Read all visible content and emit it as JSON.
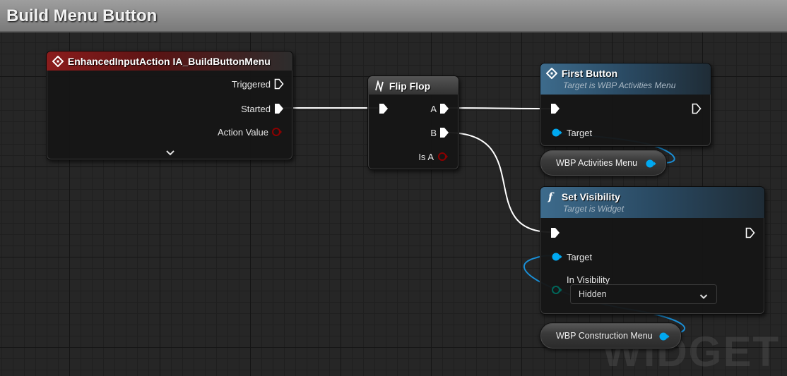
{
  "graph": {
    "title": "Build Menu Button",
    "watermark": "WIDGET"
  },
  "nodes": {
    "input_action": {
      "title": "EnhancedInputAction IA_BuildButtonMenu",
      "pins": {
        "triggered": "Triggered",
        "started": "Started",
        "action_value": "Action Value"
      },
      "accent_color": "#8b1c1c"
    },
    "flip_flop": {
      "title": "Flip Flop",
      "pins": {
        "a": "A",
        "b": "B",
        "is_a": "Is A"
      }
    },
    "first_button": {
      "title": "First Button",
      "subtitle": "Target is WBP Activities Menu",
      "pins": {
        "target": "Target"
      },
      "accent_color": "#3d6b8c"
    },
    "set_visibility": {
      "title": "Set Visibility",
      "subtitle": "Target is Widget",
      "pins": {
        "target": "Target",
        "in_visibility": "In Visibility"
      },
      "in_visibility_value": "Hidden"
    }
  },
  "variables": {
    "activities_menu": "WBP Activities Menu",
    "construction_menu": "WBP Construction Menu"
  },
  "colors": {
    "exec": "#ffffff",
    "object_pin": "#00a8f0",
    "bool_pin": "#8c0000",
    "byte_pin": "#00665a"
  },
  "icons": [
    "event-diamond-icon",
    "flipflop-icon",
    "function-icon",
    "chevron-down-icon"
  ]
}
